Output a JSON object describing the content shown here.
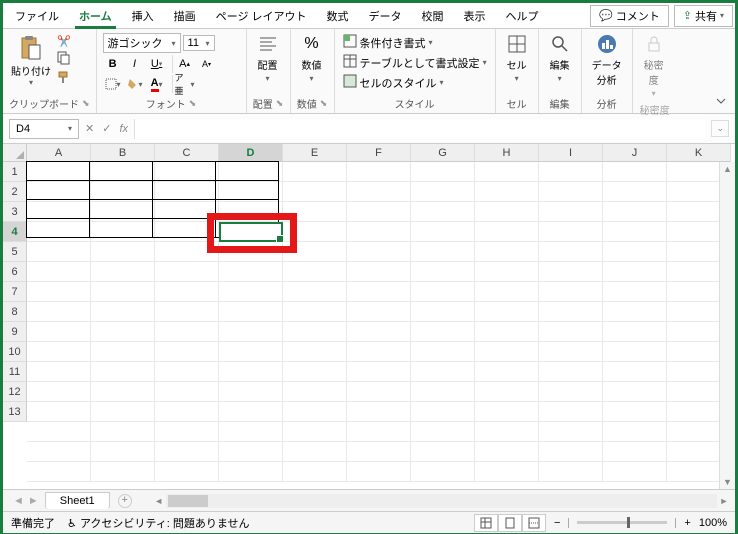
{
  "menu": {
    "tabs": [
      "ファイル",
      "ホーム",
      "挿入",
      "描画",
      "ページ レイアウト",
      "数式",
      "データ",
      "校閲",
      "表示",
      "ヘルプ"
    ],
    "active_index": 1,
    "comment": "コメント",
    "share": "共有"
  },
  "ribbon": {
    "clipboard": {
      "paste": "貼り付け",
      "label": "クリップボード"
    },
    "font": {
      "name": "游ゴシック",
      "size": "11",
      "bold": "B",
      "italic": "I",
      "underline": "U",
      "label": "フォント"
    },
    "align": {
      "label": "配置",
      "text": "配置"
    },
    "number": {
      "label": "数値",
      "text": "数値"
    },
    "styles": {
      "cond": "条件付き書式",
      "table": "テーブルとして書式設定",
      "cell": "セルのスタイル",
      "label": "スタイル"
    },
    "cells": {
      "text": "セル",
      "label": "セル"
    },
    "edit_group": {
      "text": "編集",
      "label": "編集"
    },
    "analysis": {
      "text": "データ\n分析",
      "label": "分析"
    },
    "sensitivity": {
      "text": "秘密\n度",
      "label": "秘密度"
    }
  },
  "formula": {
    "name_box": "D4",
    "cancel": "✕",
    "confirm": "✓",
    "fx": "fx",
    "value": ""
  },
  "grid": {
    "cols": [
      "A",
      "B",
      "C",
      "D",
      "E",
      "F",
      "G",
      "H",
      "I",
      "J",
      "K"
    ],
    "rows": [
      "1",
      "2",
      "3",
      "4",
      "5",
      "6",
      "7",
      "8",
      "9",
      "10",
      "11",
      "12",
      "13"
    ],
    "active_col": 3,
    "active_row": 3
  },
  "sheets": {
    "name": "Sheet1"
  },
  "status": {
    "ready": "準備完了",
    "a11y": "アクセシビリティ: 問題ありません",
    "zoom": "100%",
    "minus": "−",
    "plus": "+"
  }
}
